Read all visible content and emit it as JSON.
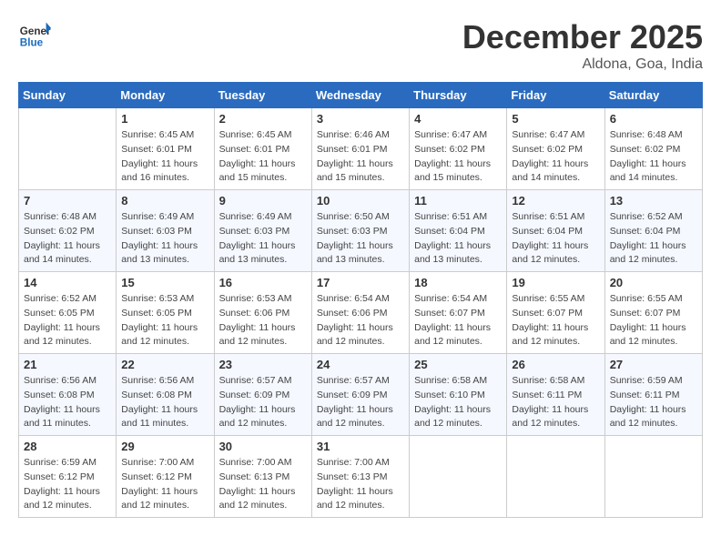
{
  "logo": {
    "general": "General",
    "blue": "Blue"
  },
  "title": "December 2025",
  "location": "Aldona, Goa, India",
  "weekdays": [
    "Sunday",
    "Monday",
    "Tuesday",
    "Wednesday",
    "Thursday",
    "Friday",
    "Saturday"
  ],
  "weeks": [
    [
      {
        "day": "",
        "info": ""
      },
      {
        "day": "1",
        "info": "Sunrise: 6:45 AM\nSunset: 6:01 PM\nDaylight: 11 hours\nand 16 minutes."
      },
      {
        "day": "2",
        "info": "Sunrise: 6:45 AM\nSunset: 6:01 PM\nDaylight: 11 hours\nand 15 minutes."
      },
      {
        "day": "3",
        "info": "Sunrise: 6:46 AM\nSunset: 6:01 PM\nDaylight: 11 hours\nand 15 minutes."
      },
      {
        "day": "4",
        "info": "Sunrise: 6:47 AM\nSunset: 6:02 PM\nDaylight: 11 hours\nand 15 minutes."
      },
      {
        "day": "5",
        "info": "Sunrise: 6:47 AM\nSunset: 6:02 PM\nDaylight: 11 hours\nand 14 minutes."
      },
      {
        "day": "6",
        "info": "Sunrise: 6:48 AM\nSunset: 6:02 PM\nDaylight: 11 hours\nand 14 minutes."
      }
    ],
    [
      {
        "day": "7",
        "info": "Sunrise: 6:48 AM\nSunset: 6:02 PM\nDaylight: 11 hours\nand 14 minutes."
      },
      {
        "day": "8",
        "info": "Sunrise: 6:49 AM\nSunset: 6:03 PM\nDaylight: 11 hours\nand 13 minutes."
      },
      {
        "day": "9",
        "info": "Sunrise: 6:49 AM\nSunset: 6:03 PM\nDaylight: 11 hours\nand 13 minutes."
      },
      {
        "day": "10",
        "info": "Sunrise: 6:50 AM\nSunset: 6:03 PM\nDaylight: 11 hours\nand 13 minutes."
      },
      {
        "day": "11",
        "info": "Sunrise: 6:51 AM\nSunset: 6:04 PM\nDaylight: 11 hours\nand 13 minutes."
      },
      {
        "day": "12",
        "info": "Sunrise: 6:51 AM\nSunset: 6:04 PM\nDaylight: 11 hours\nand 12 minutes."
      },
      {
        "day": "13",
        "info": "Sunrise: 6:52 AM\nSunset: 6:04 PM\nDaylight: 11 hours\nand 12 minutes."
      }
    ],
    [
      {
        "day": "14",
        "info": "Sunrise: 6:52 AM\nSunset: 6:05 PM\nDaylight: 11 hours\nand 12 minutes."
      },
      {
        "day": "15",
        "info": "Sunrise: 6:53 AM\nSunset: 6:05 PM\nDaylight: 11 hours\nand 12 minutes."
      },
      {
        "day": "16",
        "info": "Sunrise: 6:53 AM\nSunset: 6:06 PM\nDaylight: 11 hours\nand 12 minutes."
      },
      {
        "day": "17",
        "info": "Sunrise: 6:54 AM\nSunset: 6:06 PM\nDaylight: 11 hours\nand 12 minutes."
      },
      {
        "day": "18",
        "info": "Sunrise: 6:54 AM\nSunset: 6:07 PM\nDaylight: 11 hours\nand 12 minutes."
      },
      {
        "day": "19",
        "info": "Sunrise: 6:55 AM\nSunset: 6:07 PM\nDaylight: 11 hours\nand 12 minutes."
      },
      {
        "day": "20",
        "info": "Sunrise: 6:55 AM\nSunset: 6:07 PM\nDaylight: 11 hours\nand 12 minutes."
      }
    ],
    [
      {
        "day": "21",
        "info": "Sunrise: 6:56 AM\nSunset: 6:08 PM\nDaylight: 11 hours\nand 11 minutes."
      },
      {
        "day": "22",
        "info": "Sunrise: 6:56 AM\nSunset: 6:08 PM\nDaylight: 11 hours\nand 11 minutes."
      },
      {
        "day": "23",
        "info": "Sunrise: 6:57 AM\nSunset: 6:09 PM\nDaylight: 11 hours\nand 12 minutes."
      },
      {
        "day": "24",
        "info": "Sunrise: 6:57 AM\nSunset: 6:09 PM\nDaylight: 11 hours\nand 12 minutes."
      },
      {
        "day": "25",
        "info": "Sunrise: 6:58 AM\nSunset: 6:10 PM\nDaylight: 11 hours\nand 12 minutes."
      },
      {
        "day": "26",
        "info": "Sunrise: 6:58 AM\nSunset: 6:11 PM\nDaylight: 11 hours\nand 12 minutes."
      },
      {
        "day": "27",
        "info": "Sunrise: 6:59 AM\nSunset: 6:11 PM\nDaylight: 11 hours\nand 12 minutes."
      }
    ],
    [
      {
        "day": "28",
        "info": "Sunrise: 6:59 AM\nSunset: 6:12 PM\nDaylight: 11 hours\nand 12 minutes."
      },
      {
        "day": "29",
        "info": "Sunrise: 7:00 AM\nSunset: 6:12 PM\nDaylight: 11 hours\nand 12 minutes."
      },
      {
        "day": "30",
        "info": "Sunrise: 7:00 AM\nSunset: 6:13 PM\nDaylight: 11 hours\nand 12 minutes."
      },
      {
        "day": "31",
        "info": "Sunrise: 7:00 AM\nSunset: 6:13 PM\nDaylight: 11 hours\nand 12 minutes."
      },
      {
        "day": "",
        "info": ""
      },
      {
        "day": "",
        "info": ""
      },
      {
        "day": "",
        "info": ""
      }
    ]
  ]
}
